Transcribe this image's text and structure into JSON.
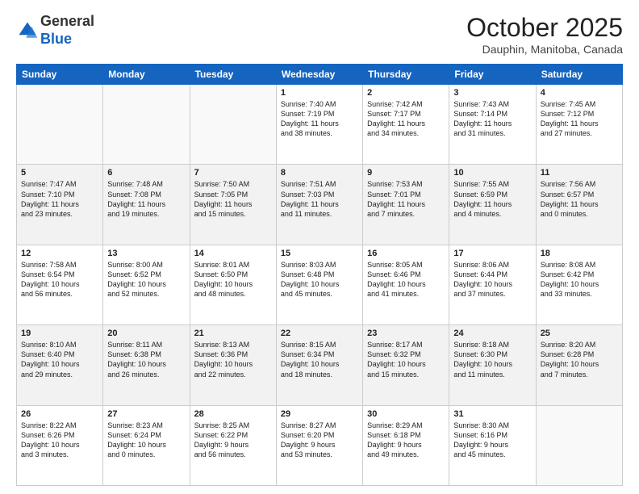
{
  "header": {
    "logo_general": "General",
    "logo_blue": "Blue",
    "month_title": "October 2025",
    "location": "Dauphin, Manitoba, Canada"
  },
  "weekdays": [
    "Sunday",
    "Monday",
    "Tuesday",
    "Wednesday",
    "Thursday",
    "Friday",
    "Saturday"
  ],
  "weeks": [
    [
      {
        "day": "",
        "info": ""
      },
      {
        "day": "",
        "info": ""
      },
      {
        "day": "",
        "info": ""
      },
      {
        "day": "1",
        "info": "Sunrise: 7:40 AM\nSunset: 7:19 PM\nDaylight: 11 hours\nand 38 minutes."
      },
      {
        "day": "2",
        "info": "Sunrise: 7:42 AM\nSunset: 7:17 PM\nDaylight: 11 hours\nand 34 minutes."
      },
      {
        "day": "3",
        "info": "Sunrise: 7:43 AM\nSunset: 7:14 PM\nDaylight: 11 hours\nand 31 minutes."
      },
      {
        "day": "4",
        "info": "Sunrise: 7:45 AM\nSunset: 7:12 PM\nDaylight: 11 hours\nand 27 minutes."
      }
    ],
    [
      {
        "day": "5",
        "info": "Sunrise: 7:47 AM\nSunset: 7:10 PM\nDaylight: 11 hours\nand 23 minutes."
      },
      {
        "day": "6",
        "info": "Sunrise: 7:48 AM\nSunset: 7:08 PM\nDaylight: 11 hours\nand 19 minutes."
      },
      {
        "day": "7",
        "info": "Sunrise: 7:50 AM\nSunset: 7:05 PM\nDaylight: 11 hours\nand 15 minutes."
      },
      {
        "day": "8",
        "info": "Sunrise: 7:51 AM\nSunset: 7:03 PM\nDaylight: 11 hours\nand 11 minutes."
      },
      {
        "day": "9",
        "info": "Sunrise: 7:53 AM\nSunset: 7:01 PM\nDaylight: 11 hours\nand 7 minutes."
      },
      {
        "day": "10",
        "info": "Sunrise: 7:55 AM\nSunset: 6:59 PM\nDaylight: 11 hours\nand 4 minutes."
      },
      {
        "day": "11",
        "info": "Sunrise: 7:56 AM\nSunset: 6:57 PM\nDaylight: 11 hours\nand 0 minutes."
      }
    ],
    [
      {
        "day": "12",
        "info": "Sunrise: 7:58 AM\nSunset: 6:54 PM\nDaylight: 10 hours\nand 56 minutes."
      },
      {
        "day": "13",
        "info": "Sunrise: 8:00 AM\nSunset: 6:52 PM\nDaylight: 10 hours\nand 52 minutes."
      },
      {
        "day": "14",
        "info": "Sunrise: 8:01 AM\nSunset: 6:50 PM\nDaylight: 10 hours\nand 48 minutes."
      },
      {
        "day": "15",
        "info": "Sunrise: 8:03 AM\nSunset: 6:48 PM\nDaylight: 10 hours\nand 45 minutes."
      },
      {
        "day": "16",
        "info": "Sunrise: 8:05 AM\nSunset: 6:46 PM\nDaylight: 10 hours\nand 41 minutes."
      },
      {
        "day": "17",
        "info": "Sunrise: 8:06 AM\nSunset: 6:44 PM\nDaylight: 10 hours\nand 37 minutes."
      },
      {
        "day": "18",
        "info": "Sunrise: 8:08 AM\nSunset: 6:42 PM\nDaylight: 10 hours\nand 33 minutes."
      }
    ],
    [
      {
        "day": "19",
        "info": "Sunrise: 8:10 AM\nSunset: 6:40 PM\nDaylight: 10 hours\nand 29 minutes."
      },
      {
        "day": "20",
        "info": "Sunrise: 8:11 AM\nSunset: 6:38 PM\nDaylight: 10 hours\nand 26 minutes."
      },
      {
        "day": "21",
        "info": "Sunrise: 8:13 AM\nSunset: 6:36 PM\nDaylight: 10 hours\nand 22 minutes."
      },
      {
        "day": "22",
        "info": "Sunrise: 8:15 AM\nSunset: 6:34 PM\nDaylight: 10 hours\nand 18 minutes."
      },
      {
        "day": "23",
        "info": "Sunrise: 8:17 AM\nSunset: 6:32 PM\nDaylight: 10 hours\nand 15 minutes."
      },
      {
        "day": "24",
        "info": "Sunrise: 8:18 AM\nSunset: 6:30 PM\nDaylight: 10 hours\nand 11 minutes."
      },
      {
        "day": "25",
        "info": "Sunrise: 8:20 AM\nSunset: 6:28 PM\nDaylight: 10 hours\nand 7 minutes."
      }
    ],
    [
      {
        "day": "26",
        "info": "Sunrise: 8:22 AM\nSunset: 6:26 PM\nDaylight: 10 hours\nand 3 minutes."
      },
      {
        "day": "27",
        "info": "Sunrise: 8:23 AM\nSunset: 6:24 PM\nDaylight: 10 hours\nand 0 minutes."
      },
      {
        "day": "28",
        "info": "Sunrise: 8:25 AM\nSunset: 6:22 PM\nDaylight: 9 hours\nand 56 minutes."
      },
      {
        "day": "29",
        "info": "Sunrise: 8:27 AM\nSunset: 6:20 PM\nDaylight: 9 hours\nand 53 minutes."
      },
      {
        "day": "30",
        "info": "Sunrise: 8:29 AM\nSunset: 6:18 PM\nDaylight: 9 hours\nand 49 minutes."
      },
      {
        "day": "31",
        "info": "Sunrise: 8:30 AM\nSunset: 6:16 PM\nDaylight: 9 hours\nand 45 minutes."
      },
      {
        "day": "",
        "info": ""
      }
    ]
  ]
}
